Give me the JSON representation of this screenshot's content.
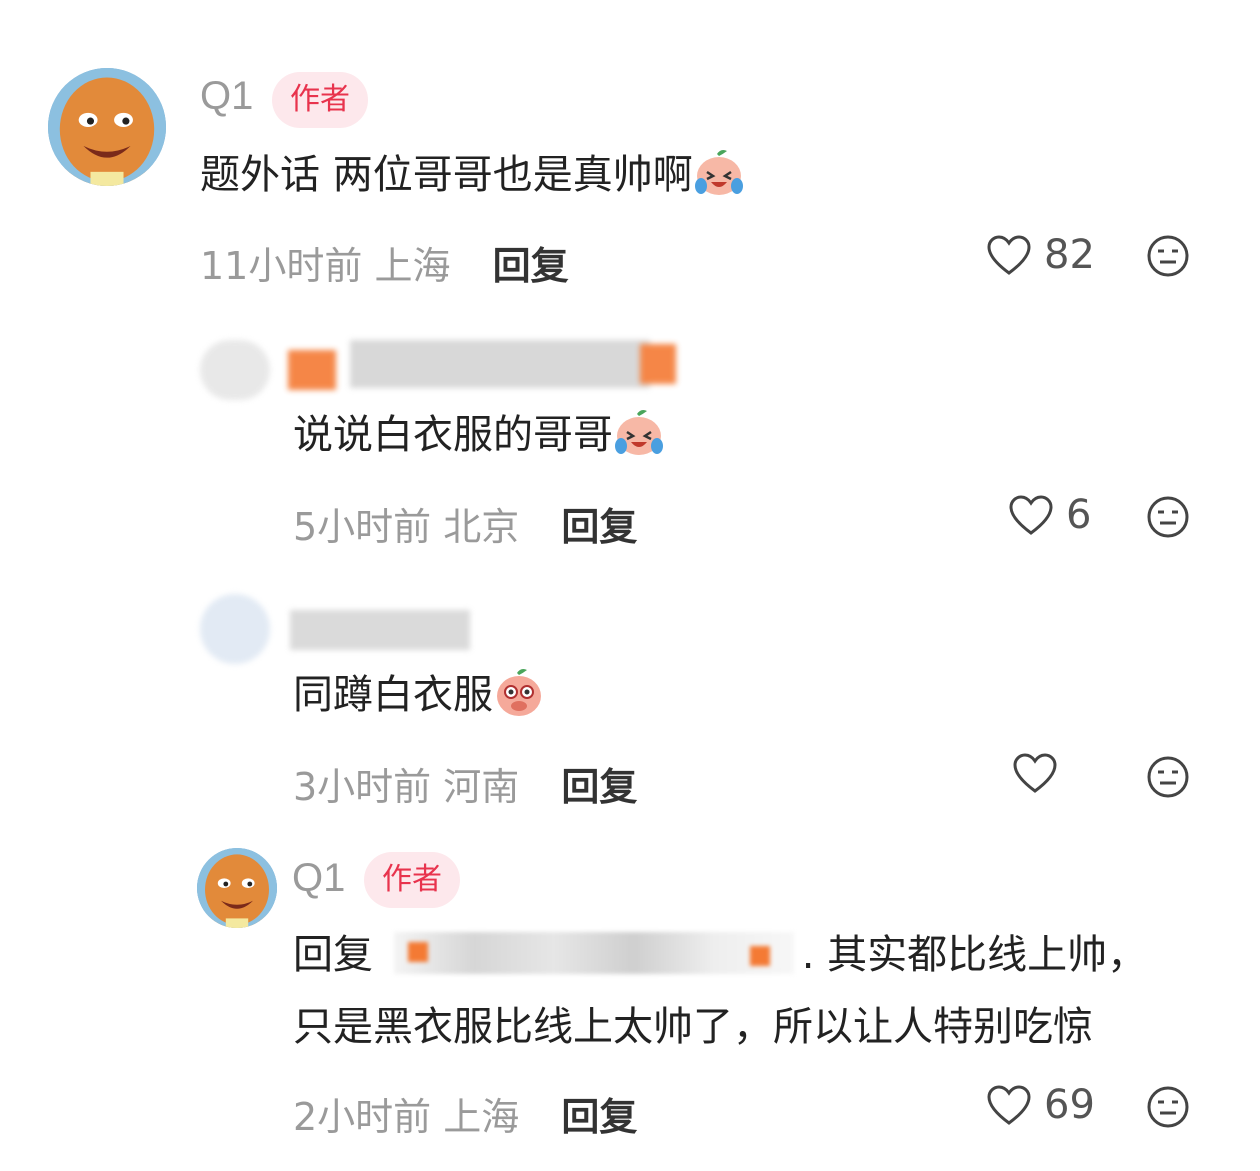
{
  "comments": [
    {
      "author": "Q1",
      "badge": "作者",
      "text": "题外话 两位哥哥也是真帅啊",
      "time": "11小时前",
      "location": "上海",
      "reply_label": "回复",
      "likes": "82"
    },
    {
      "text": "说说白衣服的哥哥",
      "time": "5小时前",
      "location": "北京",
      "reply_label": "回复",
      "likes": "6"
    },
    {
      "text": "同蹲白衣服",
      "time": "3小时前",
      "location": "河南",
      "reply_label": "回复",
      "likes": ""
    },
    {
      "author": "Q1",
      "badge": "作者",
      "text_prefix": "回复",
      "text_line1_suffix": ". 其实都比线上帅，",
      "text_line2": "只是黑衣服比线上太帅了，所以让人特别吃惊",
      "time": "2小时前",
      "location": "上海",
      "reply_label": "回复",
      "likes": "69"
    }
  ],
  "icons": {
    "like": "heart-outline-icon",
    "dislike": "neutral-face-icon",
    "emoji_laugh": "laugh-cry-emoji",
    "emoji_shy": "shy-peach-emoji"
  },
  "colors": {
    "badge_bg": "#fde8ec",
    "badge_text": "#e8334d",
    "meta_text": "#9a9a9a"
  }
}
